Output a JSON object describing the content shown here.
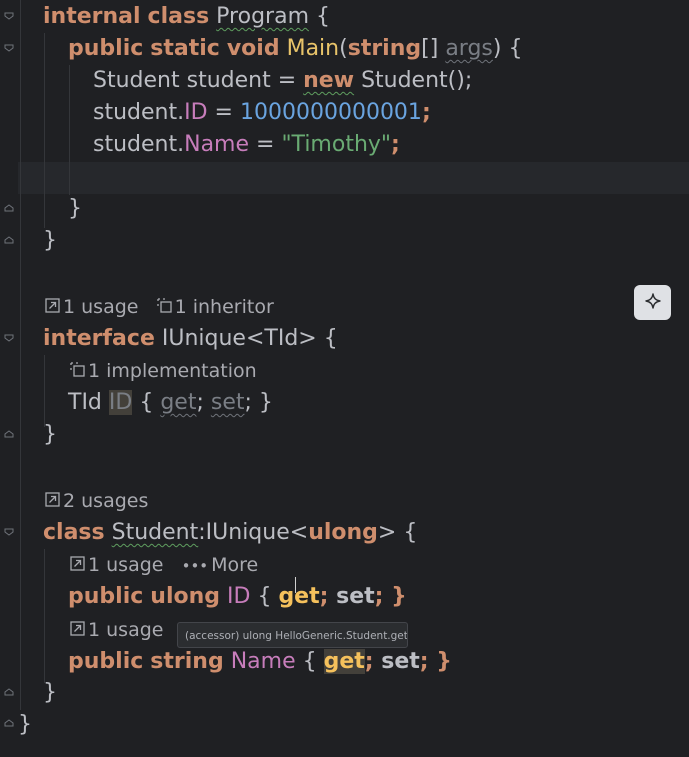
{
  "code": {
    "l1": {
      "kw1": "internal",
      "kw2": "class",
      "name": "Program",
      "brace": " {"
    },
    "l2": {
      "kw1": "public",
      "kw2": "static",
      "kw3": "void",
      "method": "Main",
      "p1": "(",
      "ptype": "string",
      "brackets": "[]",
      "param": "args",
      "p2": ") {"
    },
    "l3": {
      "type1": "Student",
      "var": "student",
      "eq": " = ",
      "kw": "new",
      "type2": "Student",
      "end": "();"
    },
    "l4": {
      "obj": "student",
      "dot": ".",
      "prop": "ID",
      "eq": " = ",
      "num": "1000000000001",
      "end": ";"
    },
    "l5": {
      "obj": "student",
      "dot": ".",
      "prop": "Name",
      "eq": " = ",
      "str": "\"Timothy\"",
      "end": ";"
    },
    "l7": {
      "brace": "}"
    },
    "l8": {
      "brace": "}"
    },
    "hint1": {
      "usage": "1 usage",
      "inheritor": "1 inheritor"
    },
    "l10": {
      "kw": "interface",
      "name": "IUnique",
      "generic": "<TId>",
      "brace": " {"
    },
    "hint2": {
      "impl": "1 implementation"
    },
    "l11": {
      "type": "TId",
      "prop": "ID",
      "open": " { ",
      "get": "get",
      "semi1": "; ",
      "set": "set",
      "semi2": "; }"
    },
    "l12": {
      "brace": "}"
    },
    "hint3": {
      "usages": "2 usages"
    },
    "l14": {
      "kw": "class",
      "name": "Student",
      "colon": ":",
      "iface": "IUnique",
      "lt": "<",
      "gtype": "ulong",
      "gt": ">",
      "brace": " {"
    },
    "hint4": {
      "usage": "1 usage",
      "more": "More"
    },
    "l15": {
      "kw1": "public",
      "kw2": "ulong",
      "prop": "ID",
      "open": " { ",
      "get": "get",
      "semi1": "; ",
      "set": "set",
      "semi2": "; }"
    },
    "hint5": {
      "usage": "1 usage"
    },
    "l16": {
      "kw1": "public",
      "kw2": "string",
      "prop": "Name",
      "open": " { ",
      "get": "get",
      "semi1": "; ",
      "set": "set",
      "semi2": "; }"
    },
    "l17": {
      "brace": "}"
    },
    "l18": {
      "brace": "}"
    }
  },
  "tooltip": {
    "text": "(accessor) ulong HelloGeneric.Student.get_ID"
  },
  "icons": {
    "usage": "arrow-up-right-icon",
    "inheritor": "implementation-icon",
    "more": "dots-icon",
    "ai": "sparkle-icon"
  }
}
